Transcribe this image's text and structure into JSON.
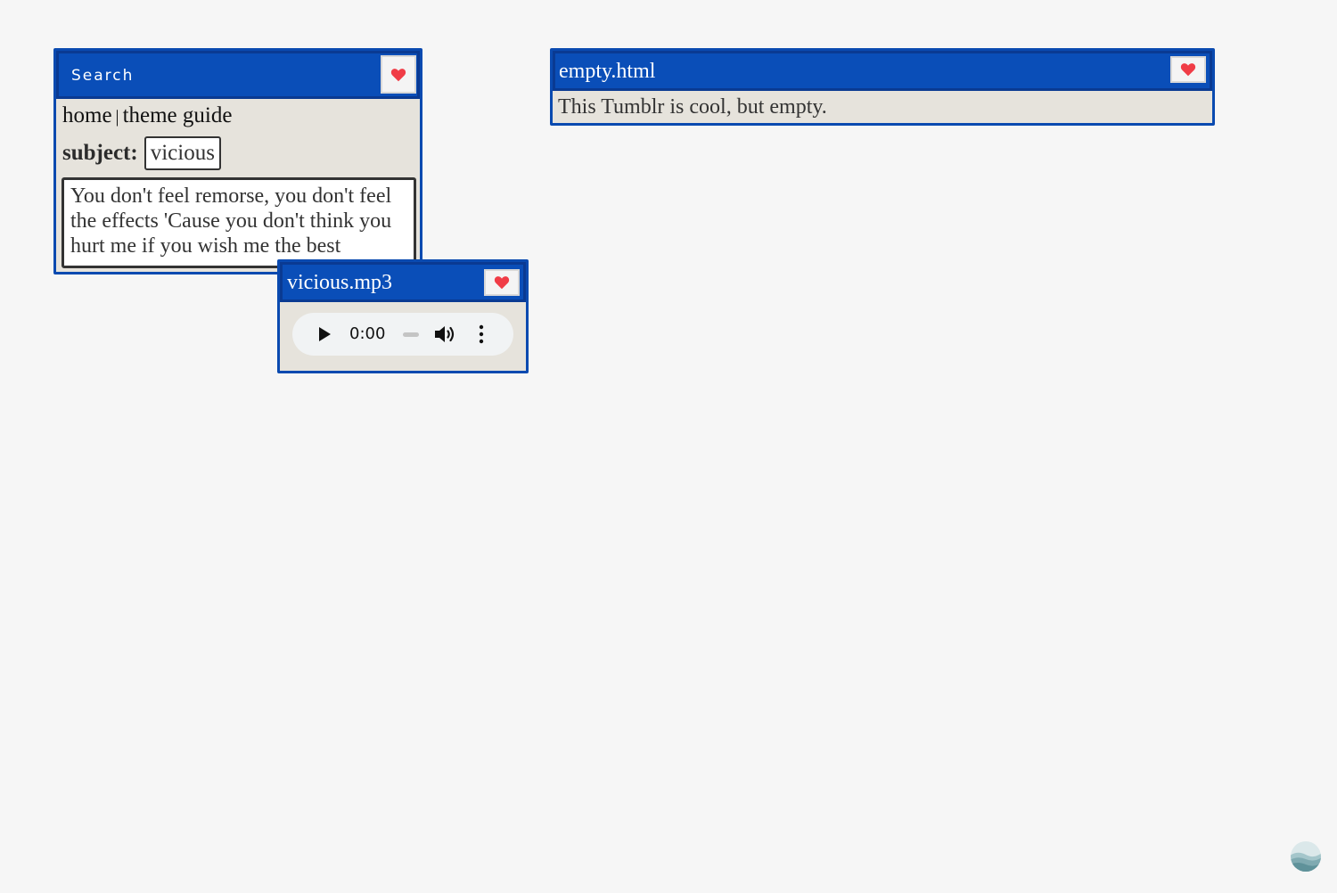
{
  "search_window": {
    "title": "Search",
    "favorite_icon": "heart-icon",
    "nav": {
      "home": "home",
      "separator": "|",
      "theme_guide": "theme guide"
    },
    "subject_label": "subject:",
    "subject_value": "vicious",
    "quote": "You don't feel remorse, you don't feel the effects 'Cause you don't think you hurt me if you wish me the best"
  },
  "audio_window": {
    "title": "vicious.mp3",
    "favorite_icon": "heart-icon",
    "player": {
      "time": "0:00",
      "progress": 0
    }
  },
  "empty_window": {
    "title": "empty.html",
    "favorite_icon": "heart-icon",
    "body": "This Tumblr is cool, but empty."
  },
  "colors": {
    "window_border": "#0a4ab0",
    "titlebar": "#0a4eb8",
    "window_body": "#e6e3dc",
    "heart": "#f03c46",
    "page_background": "#f6f6f6"
  }
}
